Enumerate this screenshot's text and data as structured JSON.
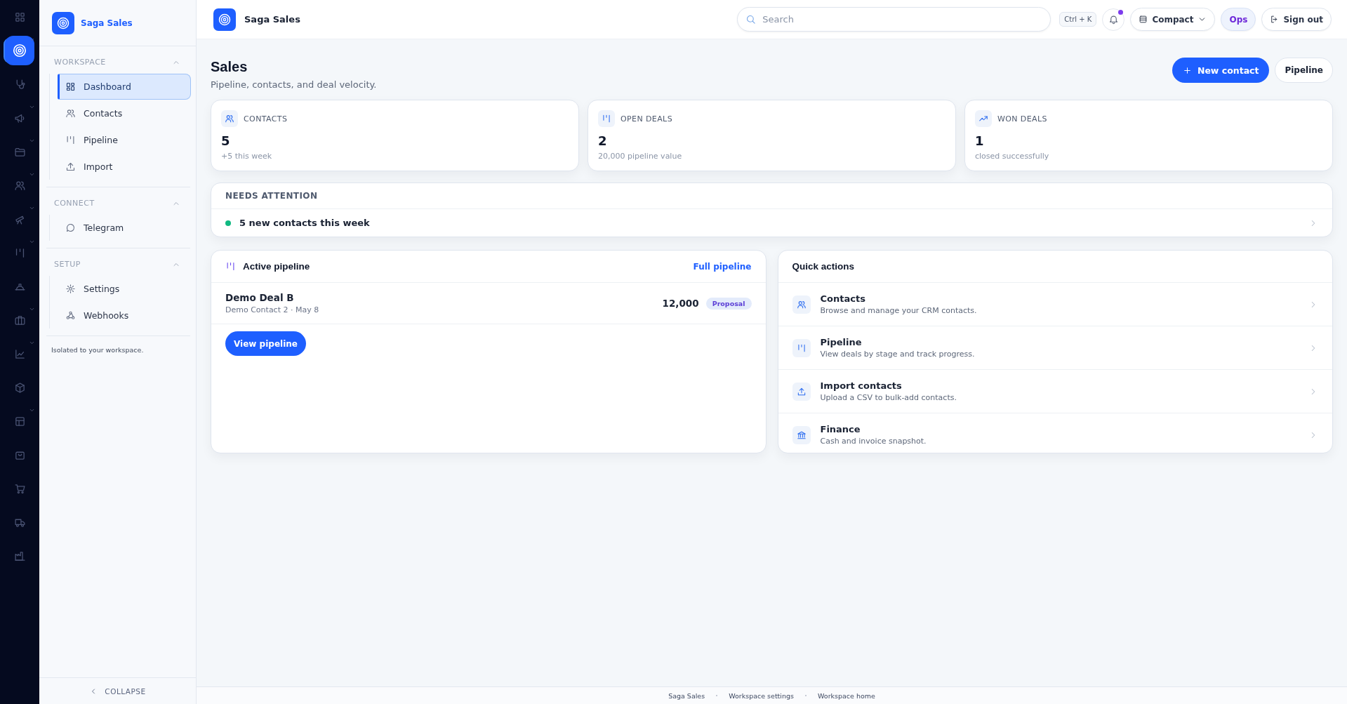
{
  "rail": [
    {
      "selected": false,
      "has_menu": false
    },
    {
      "selected": true,
      "has_menu": true
    },
    {
      "selected": false,
      "has_menu": false
    },
    {
      "selected": false,
      "has_menu": true
    },
    {
      "selected": false,
      "has_menu": true
    },
    {
      "selected": false,
      "has_menu": true
    },
    {
      "selected": false,
      "has_menu": true
    },
    {
      "selected": false,
      "has_menu": true
    },
    {
      "selected": false,
      "has_menu": false
    },
    {
      "selected": false,
      "has_menu": true
    },
    {
      "selected": false,
      "has_menu": true
    },
    {
      "selected": false,
      "has_menu": false
    },
    {
      "selected": false,
      "has_menu": true
    },
    {
      "selected": false,
      "has_menu": false
    },
    {
      "selected": false,
      "has_menu": false
    },
    {
      "selected": false,
      "has_menu": false
    },
    {
      "selected": false,
      "has_menu": false
    }
  ],
  "sidebar": {
    "brand": "Saga Sales",
    "sections": [
      {
        "title": "WORKSPACE",
        "expanded": true,
        "items": [
          {
            "label": "Dashboard",
            "selected": true
          },
          {
            "label": "Contacts",
            "selected": false
          },
          {
            "label": "Pipeline",
            "selected": false
          },
          {
            "label": "Import",
            "selected": false
          }
        ]
      },
      {
        "title": "CONNECT",
        "expanded": true,
        "items": [
          {
            "label": "Telegram",
            "selected": false
          }
        ]
      },
      {
        "title": "SETUP",
        "expanded": true,
        "items": [
          {
            "label": "Settings",
            "selected": false
          },
          {
            "label": "Webhooks",
            "selected": false
          }
        ]
      }
    ],
    "note": "Isolated to your workspace.",
    "collapse": "COLLAPSE"
  },
  "topbar": {
    "brand": "Saga Sales",
    "search": {
      "placeholder": "Search"
    },
    "shortcut": "Ctrl + K",
    "notifications_unread": true,
    "density": "Compact",
    "workspace": "Ops",
    "sign_out": "Sign out"
  },
  "header": {
    "title": "Sales",
    "subtitle": "Pipeline, contacts, and deal velocity.",
    "buttons": [
      {
        "label": "New contact",
        "kind": "primary"
      },
      {
        "label": "Pipeline",
        "kind": "secondary"
      }
    ]
  },
  "stats": [
    {
      "label": "CONTACTS",
      "value": "5",
      "note": "+5 this week"
    },
    {
      "label": "OPEN DEALS",
      "value": "2",
      "note": "20,000 pipeline value"
    },
    {
      "label": "WON DEALS",
      "value": "1",
      "note": "closed successfully"
    }
  ],
  "attention": {
    "title": "NEEDS ATTENTION",
    "items": [
      {
        "text": "5 new contacts this week",
        "color": "#10b981"
      }
    ]
  },
  "pipeline": {
    "title": "Active pipeline",
    "link": "Full pipeline",
    "deals": [
      {
        "name": "Demo Deal B",
        "meta": "Demo Contact 2 · May 8",
        "amount": "12,000",
        "stage": "Proposal"
      }
    ],
    "button": "View pipeline"
  },
  "quick_actions": {
    "title": "Quick actions",
    "items": [
      {
        "title": "Contacts",
        "description": "Browse and manage your CRM contacts."
      },
      {
        "title": "Pipeline",
        "description": "View deals by stage and track progress."
      },
      {
        "title": "Import contacts",
        "description": "Upload a CSV to bulk-add contacts."
      },
      {
        "title": "Finance",
        "description": "Cash and invoice snapshot."
      }
    ]
  },
  "footer": {
    "links": [
      "Saga Sales",
      "Workspace settings",
      "Workspace home"
    ]
  }
}
